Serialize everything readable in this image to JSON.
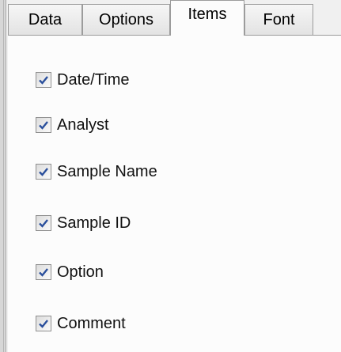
{
  "tabs": [
    {
      "id": "data",
      "label": "Data",
      "active": false
    },
    {
      "id": "options",
      "label": "Options",
      "active": false
    },
    {
      "id": "items",
      "label": "Items",
      "active": true
    },
    {
      "id": "font",
      "label": "Font",
      "active": false
    }
  ],
  "items": [
    {
      "label": "Date/Time",
      "checked": true
    },
    {
      "label": "Analyst",
      "checked": true
    },
    {
      "label": "Sample Name",
      "checked": true
    },
    {
      "label": "Sample ID",
      "checked": true
    },
    {
      "label": "Option",
      "checked": true
    },
    {
      "label": "Comment",
      "checked": true
    }
  ],
  "colors": {
    "check": "#2a4f9c",
    "panel": "#fcfcfc",
    "tab_border": "#9c9c9c"
  }
}
